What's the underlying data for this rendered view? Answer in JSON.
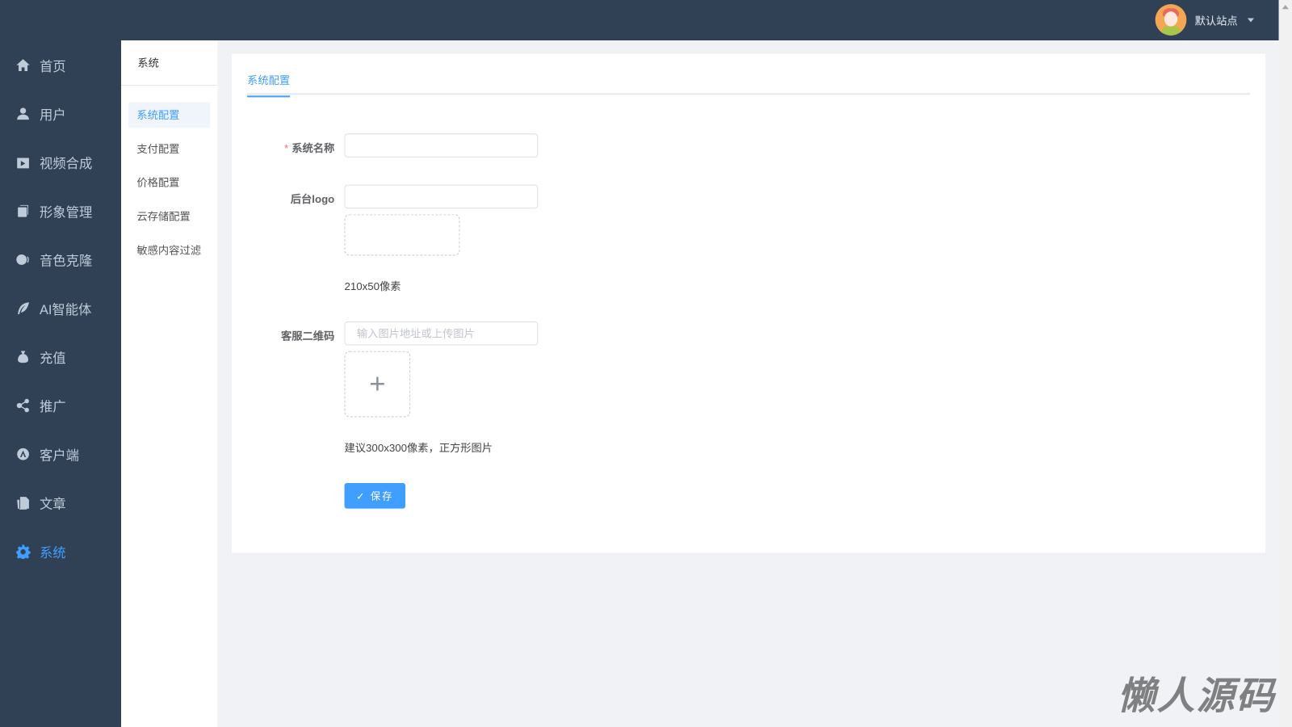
{
  "header": {
    "site_name": "默认站点"
  },
  "sidebar": {
    "items": [
      {
        "label": "首页",
        "icon": "home-icon"
      },
      {
        "label": "用户",
        "icon": "user-icon"
      },
      {
        "label": "视频合成",
        "icon": "video-icon"
      },
      {
        "label": "形象管理",
        "icon": "copy-icon"
      },
      {
        "label": "音色克隆",
        "icon": "voice-icon"
      },
      {
        "label": "AI智能体",
        "icon": "feather-icon"
      },
      {
        "label": "充值",
        "icon": "moneybag-icon"
      },
      {
        "label": "推广",
        "icon": "share-icon"
      },
      {
        "label": "客户端",
        "icon": "app-icon"
      },
      {
        "label": "文章",
        "icon": "document-icon"
      },
      {
        "label": "系统",
        "icon": "gear-icon"
      }
    ],
    "active": "系统"
  },
  "submenu": {
    "title": "系统",
    "items": [
      "系统配置",
      "支付配置",
      "价格配置",
      "云存储配置",
      "敏感内容过滤"
    ],
    "active": "系统配置"
  },
  "main": {
    "tab": "系统配置",
    "form": {
      "system_name_label": "系统名称",
      "required_mark": "*",
      "logo_label": "后台logo",
      "logo_hint": "210x50像素",
      "qr_label": "客服二维码",
      "qr_placeholder": "输入图片地址或上传图片",
      "qr_hint": "建议300x300像素，正方形图片",
      "save_label": "✓ 保存"
    }
  },
  "watermark": "懒人源码",
  "colors": {
    "sidebar": "#304156",
    "accent": "#409eff"
  }
}
